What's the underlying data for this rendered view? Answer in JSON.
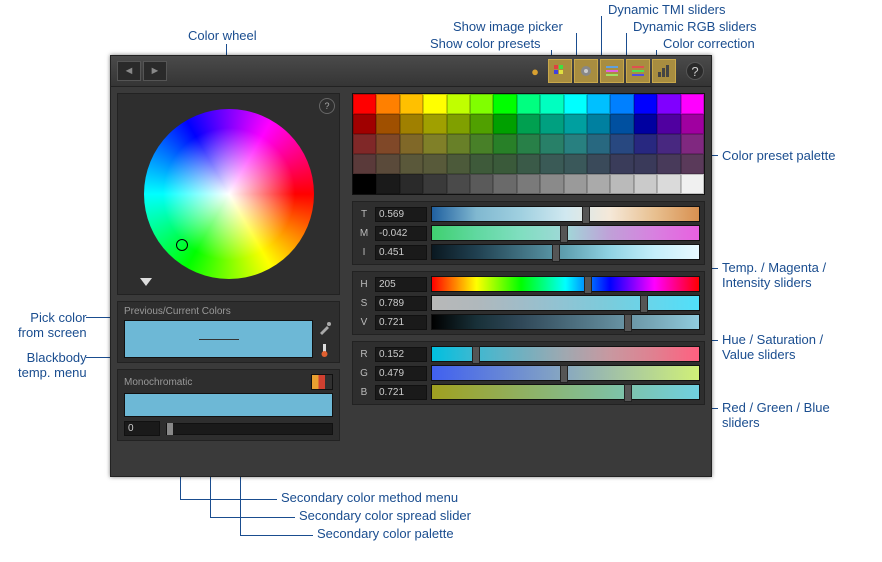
{
  "callouts": {
    "color_wheel": "Color wheel",
    "show_color_presets": "Show color presets",
    "show_image_picker": "Show image picker",
    "dynamic_tmi": "Dynamic TMI sliders",
    "dynamic_rgb": "Dynamic RGB sliders",
    "color_correction": "Color correction",
    "color_preset_palette": "Color preset palette",
    "tmi_sliders": "Temp. / Magenta /\nIntensity sliders",
    "hsv_sliders": "Hue / Saturation /\nValue sliders",
    "rgb_sliders": "Red / Green / Blue\nsliders",
    "pick_from_screen": "Pick color\nfrom screen",
    "blackbody_menu": "Blackbody\ntemp. menu",
    "secondary_method": "Secondary color method menu",
    "secondary_spread": "Secondary color spread slider",
    "secondary_palette": "Secondary color palette"
  },
  "sections": {
    "prev_current": "Previous/Current Colors",
    "secondary_method_label": "Monochromatic",
    "spread_value": "0"
  },
  "tmi": {
    "t_label": "T",
    "t_val": "0.569",
    "m_label": "M",
    "m_val": "-0.042",
    "i_label": "I",
    "i_val": "0.451"
  },
  "hsv": {
    "h_label": "H",
    "h_val": "205",
    "s_label": "S",
    "s_val": "0.789",
    "v_label": "V",
    "v_val": "0.721"
  },
  "rgb": {
    "r_label": "R",
    "r_val": "0.152",
    "g_label": "G",
    "g_val": "0.479",
    "b_label": "B",
    "b_val": "0.721"
  },
  "preset_colors": [
    "#ff0000",
    "#ff8000",
    "#ffc000",
    "#ffff00",
    "#c0ff00",
    "#80ff00",
    "#00ff00",
    "#00ff80",
    "#00ffc0",
    "#00ffff",
    "#00c0ff",
    "#0080ff",
    "#0000ff",
    "#8000ff",
    "#ff00ff",
    "#a00000",
    "#a05000",
    "#a08000",
    "#a0a000",
    "#80a000",
    "#50a000",
    "#00a000",
    "#00a050",
    "#00a080",
    "#00a0a0",
    "#0080a0",
    "#0050a0",
    "#0000a0",
    "#5000a0",
    "#a000a0",
    "#802828",
    "#804828",
    "#806828",
    "#808028",
    "#688028",
    "#488028",
    "#288028",
    "#288048",
    "#288068",
    "#288080",
    "#286880",
    "#284880",
    "#282880",
    "#482880",
    "#802880",
    "#5a3a3a",
    "#5a4a3a",
    "#5a583a",
    "#585a3a",
    "#4c5a3a",
    "#3e5a3a",
    "#3a5a3a",
    "#3a5a48",
    "#3a5a56",
    "#3a585a",
    "#3a4a5a",
    "#3a3c5a",
    "#3a3a5a",
    "#483a5a",
    "#5a3a5a",
    "#000000",
    "#1a1a1a",
    "#2a2a2a",
    "#3a3a3a",
    "#4a4a4a",
    "#5a5a5a",
    "#6a6a6a",
    "#7a7a7a",
    "#8a8a8a",
    "#9a9a9a",
    "#aaaaaa",
    "#bababa",
    "#cacaca",
    "#dadada",
    "#f0f0f0"
  ],
  "icons": {
    "help": "?",
    "back": "◄",
    "forward": "►"
  }
}
